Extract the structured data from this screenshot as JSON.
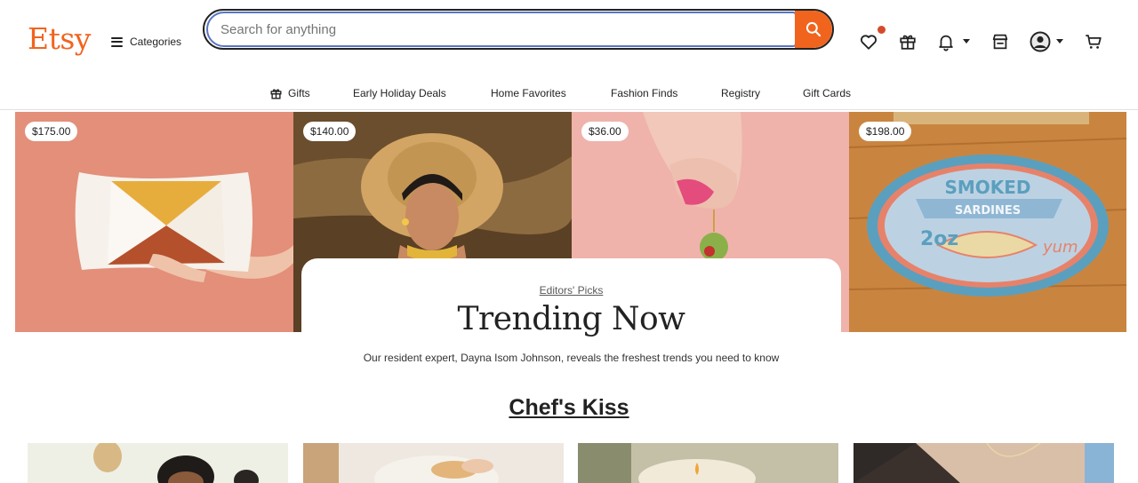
{
  "header": {
    "logo": "Etsy",
    "categories_label": "Categories",
    "search_placeholder": "Search for anything"
  },
  "nav": {
    "items": [
      {
        "label": "Gifts",
        "icon": "gift-icon"
      },
      {
        "label": "Early Holiday Deals"
      },
      {
        "label": "Home Favorites"
      },
      {
        "label": "Fashion Finds"
      },
      {
        "label": "Registry"
      },
      {
        "label": "Gift Cards"
      }
    ]
  },
  "hero": {
    "tiles": [
      {
        "price": "$175.00",
        "subject": "pillow"
      },
      {
        "price": "$140.00",
        "subject": "hat-portrait"
      },
      {
        "price": "$36.00",
        "subject": "olive-earring"
      },
      {
        "price": "$198.00",
        "subject": "sardine-rug"
      }
    ],
    "rug_text": {
      "line1": "SMOKED",
      "line2": "SARDINES",
      "line3": "2oz",
      "line4": "yum"
    },
    "eyebrow": "Editors' Picks",
    "title": "Trending Now",
    "description": "Our resident expert, Dayna Isom Johnson, reveals the freshest trends you need to know"
  },
  "section": {
    "title": "Chef's Kiss"
  },
  "colors": {
    "brand": "#f1641e",
    "focus": "#5776c2",
    "notification": "#d54a2b"
  }
}
